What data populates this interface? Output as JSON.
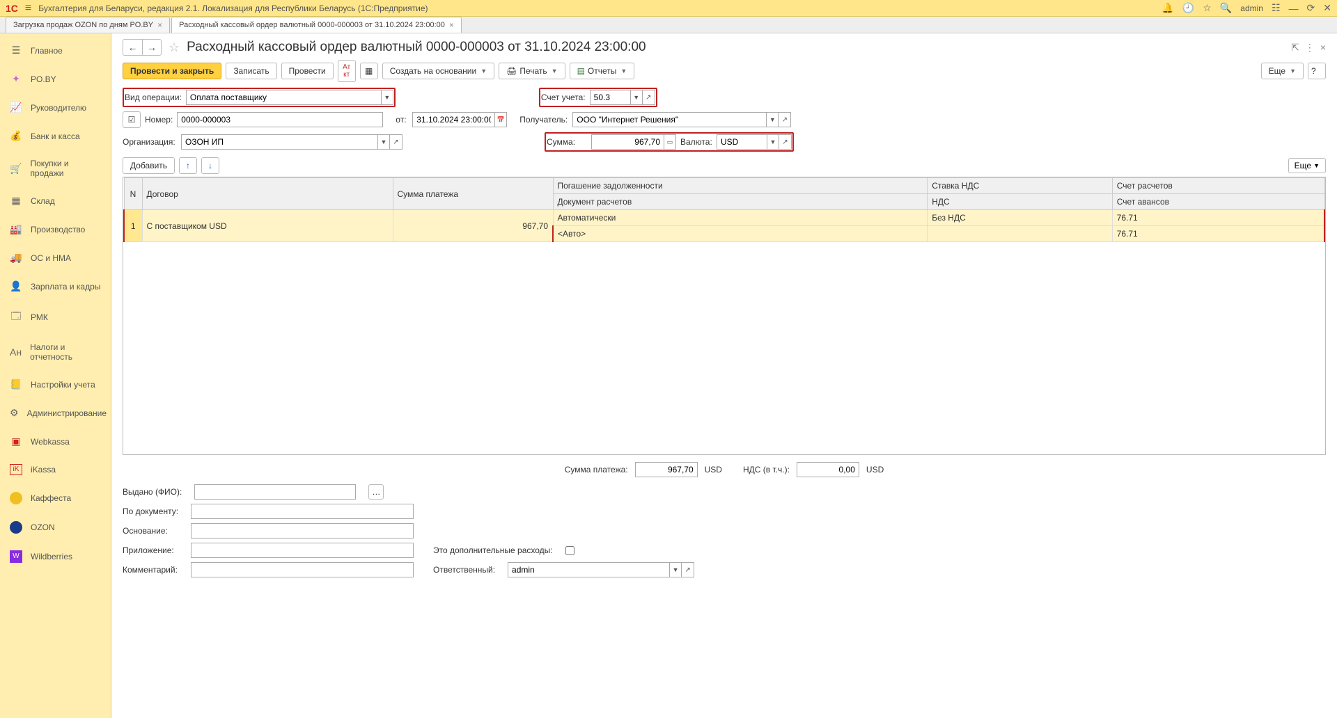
{
  "titlebar": {
    "title": "Бухгалтерия для Беларуси, редакция 2.1. Локализация для Республики Беларусь  (1С:Предприятие)",
    "user": "admin"
  },
  "tabs": [
    {
      "label": "Загрузка продаж OZON по дням PO.BY",
      "active": false
    },
    {
      "label": "Расходный кассовый ордер валютный 0000-000003 от 31.10.2024 23:00:00",
      "active": true
    }
  ],
  "sidebar": [
    {
      "icon": "home",
      "label": "Главное"
    },
    {
      "icon": "poby",
      "label": "PO.BY"
    },
    {
      "icon": "chart",
      "label": "Руководителю"
    },
    {
      "icon": "bank",
      "label": "Банк и касса"
    },
    {
      "icon": "cart",
      "label": "Покупки и продажи"
    },
    {
      "icon": "warehouse",
      "label": "Склад"
    },
    {
      "icon": "factory",
      "label": "Производство"
    },
    {
      "icon": "truck",
      "label": "ОС и НМА"
    },
    {
      "icon": "person",
      "label": "Зарплата и кадры"
    },
    {
      "icon": "rmk",
      "label": "РМК"
    },
    {
      "icon": "tax",
      "label": "Налоги и отчетность"
    },
    {
      "icon": "settings",
      "label": "Настройки учета"
    },
    {
      "icon": "gear",
      "label": "Администрирование"
    },
    {
      "icon": "webkassa",
      "label": "Webkassa"
    },
    {
      "icon": "ikassa",
      "label": "iKassa"
    },
    {
      "icon": "kaffesta",
      "label": "Каффеста"
    },
    {
      "icon": "ozon",
      "label": "OZON"
    },
    {
      "icon": "wb",
      "label": "Wildberries"
    }
  ],
  "page": {
    "title": "Расходный кассовый ордер валютный 0000-000003 от 31.10.2024 23:00:00"
  },
  "toolbar": {
    "post_close": "Провести и закрыть",
    "write": "Записать",
    "post": "Провести",
    "create_based": "Создать на основании",
    "print": "Печать",
    "reports": "Отчеты",
    "more": "Еще",
    "help": "?"
  },
  "form": {
    "operation_type_label": "Вид операции:",
    "operation_type": "Оплата поставщику",
    "account_label": "Счет учета:",
    "account": "50.3",
    "number_label": "Номер:",
    "number": "0000-000003",
    "from_label": "от:",
    "date": "31.10.2024 23:00:00",
    "recipient_label": "Получатель:",
    "recipient": "ООО \"Интернет Решения\"",
    "org_label": "Организация:",
    "org": "ОЗОН ИП",
    "sum_label": "Сумма:",
    "sum": "967,70",
    "currency_label": "Валюта:",
    "currency": "USD"
  },
  "table_toolbar": {
    "add": "Добавить",
    "more": "Еще"
  },
  "table": {
    "columns_row1": [
      "N",
      "Договор",
      "Сумма платежа",
      "Погашение задолженности",
      "Ставка НДС",
      "Счет расчетов"
    ],
    "columns_row2": [
      "",
      "",
      "",
      "Документ расчетов",
      "НДС",
      "Счет авансов"
    ],
    "rows": [
      {
        "n": "1",
        "contract": "С поставщиком USD",
        "amount": "967,70",
        "repayment": "Автоматически",
        "vat_rate": "Без НДС",
        "settle_acc": "76.71",
        "doc": "<Авто>",
        "vat": "",
        "advance_acc": "76.71"
      }
    ]
  },
  "totals": {
    "payment_sum_label": "Сумма платежа:",
    "payment_sum": "967,70",
    "payment_cur": "USD",
    "vat_label": "НДС (в т.ч.):",
    "vat": "0,00",
    "vat_cur": "USD"
  },
  "bottom": {
    "issued_label": "Выдано (ФИО):",
    "by_doc_label": "По документу:",
    "basis_label": "Основание:",
    "attachment_label": "Приложение:",
    "extra_costs_label": "Это дополнительные расходы:",
    "comment_label": "Комментарий:",
    "responsible_label": "Ответственный:",
    "responsible": "admin"
  }
}
